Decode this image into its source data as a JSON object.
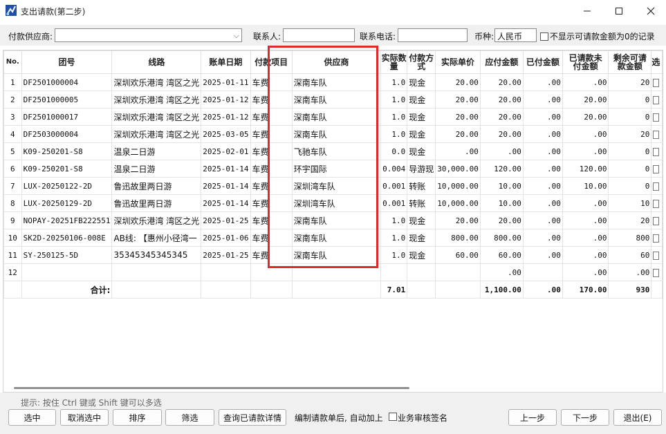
{
  "window": {
    "title": "支出请款(第二步)"
  },
  "toolbar": {
    "supplier_label": "付款供应商:",
    "supplier_value": "",
    "contact_label": "联系人:",
    "contact_value": "",
    "phone_label": "联系电话:",
    "phone_value": "",
    "currency_label": "币种:",
    "currency_value": "人民币",
    "hide_zero_label": "不显示可请款金额为0的记录"
  },
  "table": {
    "headers": [
      "No.",
      "团号",
      "线路",
      "账单日期",
      "付款项目",
      "供应商",
      "实际数量",
      "付款方式",
      "实际单价",
      "应付金额",
      "已付金额",
      "已请款未付金额",
      "剩余可请款金额",
      "选"
    ],
    "rows": [
      [
        "1",
        "DF2501000004",
        "深圳欢乐港湾 湾区之光",
        "2025-01-11",
        "车费",
        "深南车队",
        "1.0",
        "现金",
        "20.00",
        "20.00",
        ".00",
        ".00",
        "20"
      ],
      [
        "2",
        "DF2501000005",
        "深圳欢乐港湾 湾区之光",
        "2025-01-12",
        "车费",
        "深南车队",
        "1.0",
        "现金",
        "20.00",
        "20.00",
        ".00",
        "20.00",
        "0"
      ],
      [
        "3",
        "DF2501000017",
        "深圳欢乐港湾 湾区之光",
        "2025-01-12",
        "车费",
        "深南车队",
        "1.0",
        "现金",
        "20.00",
        "20.00",
        ".00",
        "20.00",
        "0"
      ],
      [
        "4",
        "DF2503000004",
        "深圳欢乐港湾 湾区之光",
        "2025-03-05",
        "车费",
        "深南车队",
        "1.0",
        "现金",
        "20.00",
        "20.00",
        ".00",
        ".00",
        "20"
      ],
      [
        "5",
        "K09-250201-S8",
        "温泉二日游",
        "2025-02-01",
        "车费",
        "飞驰车队",
        "0.0",
        "现金",
        ".00",
        ".00",
        ".00",
        ".00",
        "0"
      ],
      [
        "6",
        "K09-250201-S8",
        "温泉二日游",
        "2025-01-14",
        "车费",
        "环宇国际",
        "0.004",
        "导游现",
        "30,000.00",
        "120.00",
        ".00",
        "120.00",
        "0"
      ],
      [
        "7",
        "LUX-20250122-2D",
        "鲁迅故里两日游",
        "2025-01-14",
        "车费",
        "深圳湾车队",
        "0.001",
        "转账",
        "10,000.00",
        "10.00",
        ".00",
        "10.00",
        "0"
      ],
      [
        "8",
        "LUX-20250129-2D",
        "鲁迅故里两日游",
        "2025-01-14",
        "车费",
        "深圳湾车队",
        "0.001",
        "转账",
        "10,000.00",
        "10.00",
        ".00",
        ".00",
        "10"
      ],
      [
        "9",
        "NOPAY-20251FB222551",
        "深圳欢乐港湾 湾区之光",
        "2025-01-25",
        "车费",
        "深南车队",
        "1.0",
        "现金",
        "20.00",
        "20.00",
        ".00",
        ".00",
        "20"
      ],
      [
        "10",
        "SK2D-20250106-008E",
        "AB线: 【惠州小径湾一",
        "2025-01-06",
        "车费",
        "深南车队",
        "1.0",
        "现金",
        "800.00",
        "800.00",
        ".00",
        ".00",
        "800"
      ],
      [
        "11",
        "SY-250125-5D",
        "35345345345345",
        "2025-01-25",
        "车费",
        "深南车队",
        "1.0",
        "现金",
        "60.00",
        "60.00",
        ".00",
        ".00",
        "60"
      ],
      [
        "12",
        "",
        "",
        "",
        "",
        "",
        "",
        "",
        "",
        ".00",
        "",
        ".00",
        ".00"
      ]
    ],
    "total": {
      "label": "合计:",
      "qty": "7.01",
      "payable": "1,100.00",
      "paid": ".00",
      "requested": "170.00",
      "remaining": "930"
    }
  },
  "footer": {
    "hint": "提示: 按住 Ctrl 键或 Shift 键可以多选",
    "select_label": "选中",
    "deselect_label": "取消选中",
    "sort_label": "排序",
    "filter_label": "筛选",
    "query_label": "查询已请款详情",
    "auto_add_note": "编制请款单后, 自动加上",
    "sign_label": "业务审核签名",
    "prev_label": "上一步",
    "next_label": "下一步",
    "exit_label": "退出(E)"
  },
  "colors": {
    "highlight": "#e02a2a",
    "app_icon": "#1f5fbf"
  },
  "icons": [
    "app-icon",
    "minimize-icon",
    "maximize-icon",
    "close-icon",
    "chevron-down-icon"
  ]
}
